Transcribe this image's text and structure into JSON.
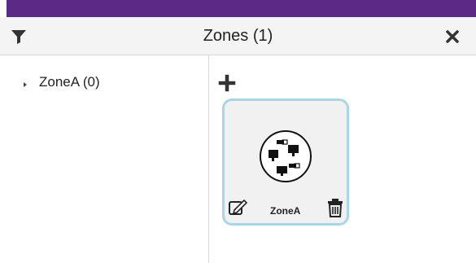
{
  "header": {
    "title": "Zones (1)",
    "filter_icon": "filter-icon",
    "close_icon": "close-icon"
  },
  "zones_tree": {
    "items": [
      {
        "label": "ZoneA (0)",
        "expanded": false
      }
    ]
  },
  "zone_cards": [
    {
      "name": "ZoneA",
      "icon": "network-devices-icon"
    }
  ],
  "actions": {
    "add_icon": "plus-icon",
    "edit_icon": "edit-icon",
    "delete_icon": "trash-icon"
  },
  "colors": {
    "top_strip": "#5b2a86",
    "card_border": "#a9d6e5",
    "card_background": "#f1f1f1"
  }
}
